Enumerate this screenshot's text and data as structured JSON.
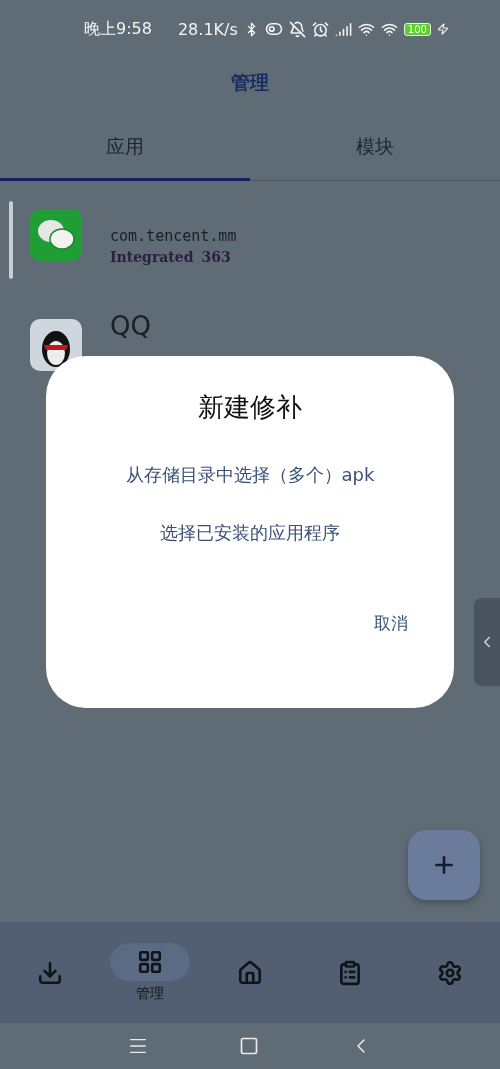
{
  "status_bar": {
    "time": "晚上9:58",
    "speed": "28.1K/s",
    "battery": "100"
  },
  "app_bar": {
    "title": "管理"
  },
  "tabs": [
    {
      "label": "应用",
      "selected": true
    },
    {
      "label": "模块",
      "selected": false
    }
  ],
  "apps": [
    {
      "package": "com.tencent.mm",
      "mode": "Integrated",
      "version": "363",
      "selected": true
    },
    {
      "name": "QQ",
      "selected": false
    }
  ],
  "dialog": {
    "title": "新建修补",
    "options": [
      "从存储目录中选择（多个）apk",
      "选择已安装的应用程序"
    ],
    "cancel": "取消"
  },
  "bottom_nav": [
    {
      "selected": false
    },
    {
      "label": "管理",
      "selected": true
    },
    {
      "selected": false
    },
    {
      "selected": false
    },
    {
      "selected": false
    }
  ]
}
